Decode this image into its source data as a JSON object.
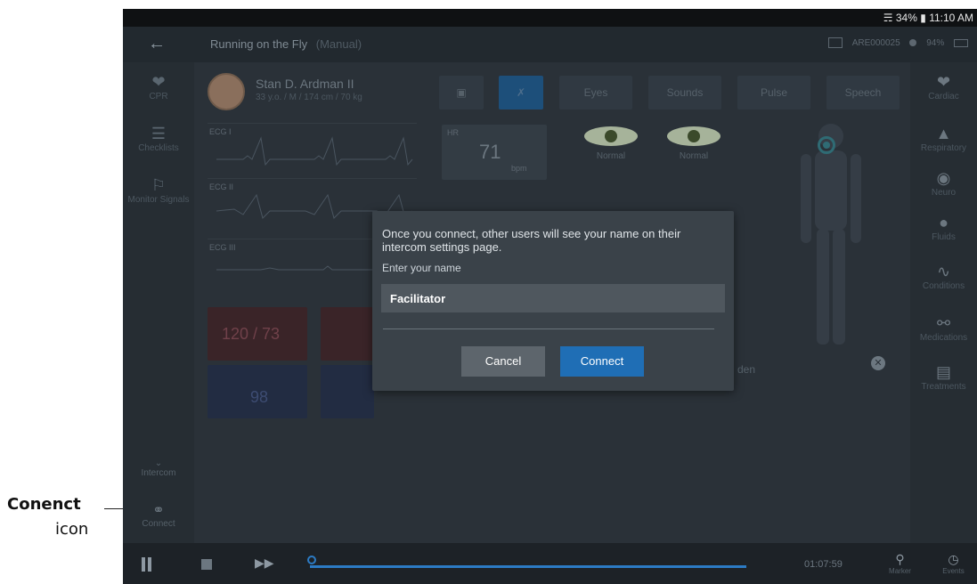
{
  "annotation": {
    "title": "Conenct",
    "subtitle": "icon"
  },
  "statusbar": {
    "wifi_battery": "34%",
    "time": "11:10 AM"
  },
  "topbar": {
    "scenario_title": "Running on the Fly",
    "scenario_mode": "(Manual)",
    "device_id": "ARE000025",
    "device_battery": "94%"
  },
  "left_nav": [
    {
      "label": "CPR",
      "icon": "heart-pulse-icon"
    },
    {
      "label": "Checklists",
      "icon": "checklist-icon"
    },
    {
      "label": "Monitor Signals",
      "icon": "monitor-signals-icon"
    }
  ],
  "right_nav": [
    {
      "label": "Cardiac",
      "icon": "heart-icon"
    },
    {
      "label": "Respiratory",
      "icon": "lungs-icon"
    },
    {
      "label": "Neuro",
      "icon": "brain-icon"
    },
    {
      "label": "Fluids",
      "icon": "drop-icon"
    },
    {
      "label": "Conditions",
      "icon": "pulse-icon"
    },
    {
      "label": "Medications",
      "icon": "pill-icon"
    },
    {
      "label": "Treatments",
      "icon": "first-aid-icon"
    }
  ],
  "patient": {
    "name": "Stan D. Ardman II",
    "info": "33 y.o. / M / 174 cm / 70 kg"
  },
  "ecg": [
    "ECG I",
    "ECG II",
    "ECG III"
  ],
  "tabs": [
    "Eyes",
    "Sounds",
    "Pulse",
    "Speech"
  ],
  "hr": {
    "label": "HR",
    "value": "71",
    "unit": "bpm"
  },
  "eyes": [
    {
      "label": "Normal"
    },
    {
      "label": "Normal"
    }
  ],
  "vitals": {
    "bp": "120 / 73",
    "spo2_value": "98"
  },
  "background_text": "den",
  "modal": {
    "message": "Once you connect, other users will see your name on their intercom settings page.",
    "name_label": "Enter your name",
    "name_value": "Facilitator",
    "cancel": "Cancel",
    "connect": "Connect"
  },
  "intercom": {
    "label": "Intercom"
  },
  "connect_nav": {
    "label": "Connect",
    "icon": "connect-link-icon"
  },
  "bottombar": {
    "elapsed": "01:07:59",
    "marker_label": "Marker",
    "events_label": "Events"
  }
}
